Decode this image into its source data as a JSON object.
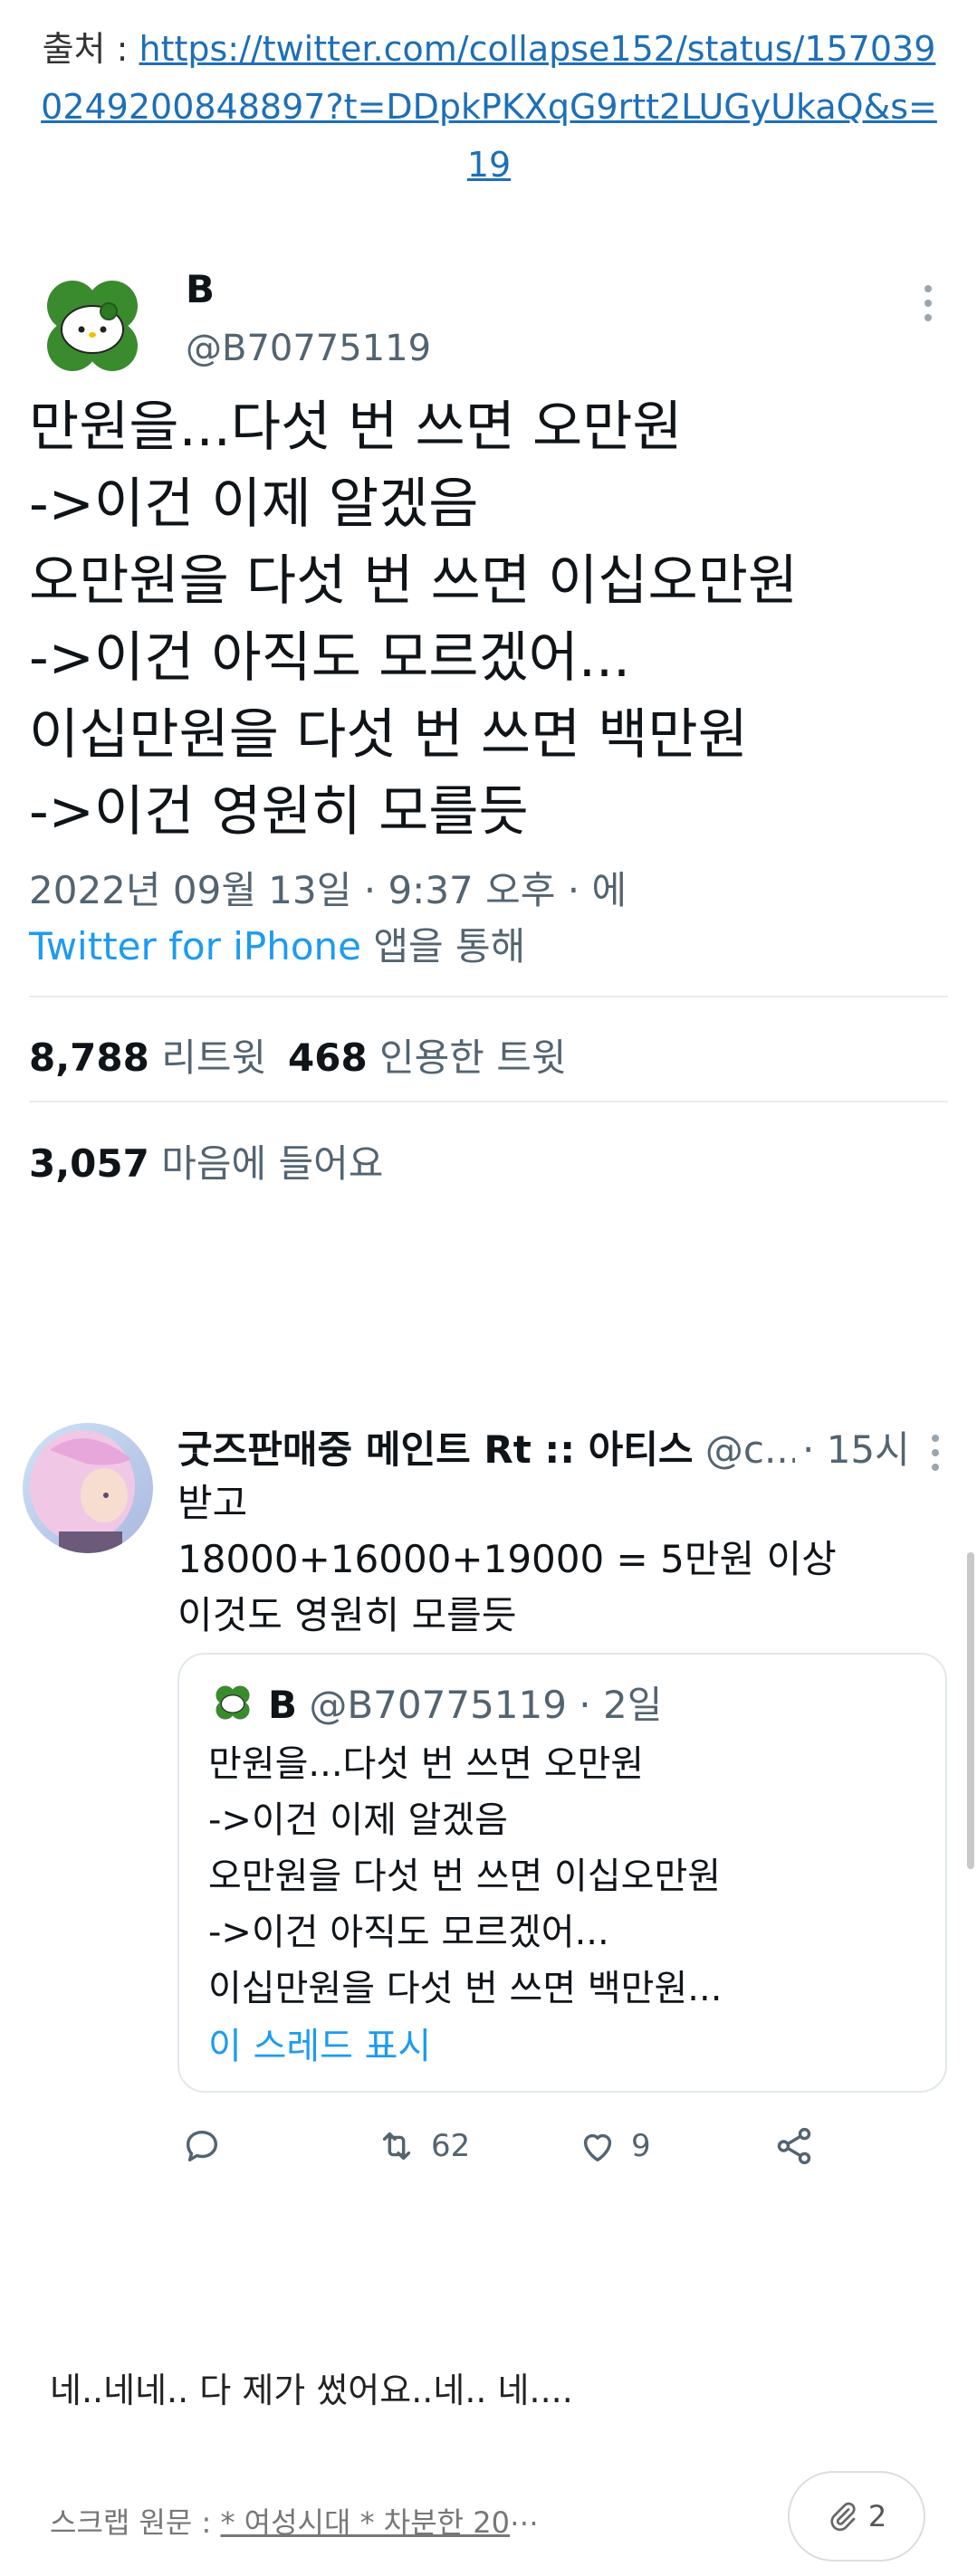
{
  "source": {
    "label": "출처 : ",
    "url": "https://twitter.com/collapse152/status/1570390249200848897?t=DDpkPKXqG9rtt2LUGyUkaQ&s=19"
  },
  "tweet": {
    "name": "B",
    "handle": "@B70775119",
    "lines": [
      "만원을...다섯 번 쓰면 오만원",
      "->이건 이제 알겠음",
      "오만원을 다섯 번 쓰면 이십오만원",
      "->이건 아직도 모르겠어...",
      "이십만원을 다섯 번 쓰면 백만원",
      "->이건 영원히 모를듯"
    ],
    "timestamp": "2022년 09월 13일 · 9:37 오후 · 에",
    "via_app": "Twitter for iPhone",
    "via_suffix": " 앱을 통해",
    "retweets": "8,788",
    "retweets_label": " 리트윗",
    "quotes": "468",
    "quotes_label": " 인용한 트윗",
    "likes": "3,057",
    "likes_label": " 마음에 들어요"
  },
  "reply": {
    "name": "굿즈판매중 메인트 Rt :: 아티스",
    "handle": " @c...",
    "time": "· 15시",
    "lines": [
      "받고",
      "18000+16000+19000 = 5만원 이상",
      "이것도 영원히 모를듯"
    ],
    "quoted": {
      "name": "B",
      "handle": " @B70775119 · 2일",
      "lines": [
        "만원을...다섯 번 쓰면 오만원",
        "->이건 이제 알겠음",
        "오만원을 다섯 번 쓰면 이십오만원",
        "->이건 아직도 모르겠어...",
        "이십만원을 다섯 번 쓰면 백만원..."
      ],
      "show_thread": "이 스레드 표시"
    },
    "actions": {
      "reply_count": "",
      "retweet_count": "62",
      "like_count": "9"
    }
  },
  "closing_text": "네..네네.. 다 제가 썼어요..네.. 네....",
  "scrap": {
    "label": "스크랩 원문 : ",
    "title": "* 여성시대 * 차분한 20"
  },
  "attachment_count": "2",
  "colors": {
    "link": "#1d6fb8",
    "twitter_blue": "#1d9bf0",
    "secondary_text": "#536471"
  }
}
